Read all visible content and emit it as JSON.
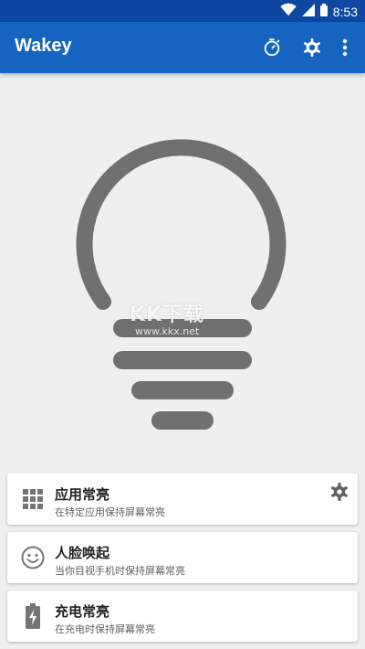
{
  "status_bar": {
    "time": "8:53",
    "icons": [
      "wifi-icon",
      "cellular-signal-icon",
      "battery-icon"
    ],
    "background": "#0d47a1"
  },
  "app_bar": {
    "title": "Wakey",
    "background": "#1565c0",
    "actions": [
      "timer-icon",
      "settings-icon",
      "more-vert-icon"
    ]
  },
  "bulb": {
    "color": "#707070",
    "icon": "lightbulb-icon"
  },
  "watermark": {
    "main": "KK下载",
    "sub": "www.kkx.net"
  },
  "cards": [
    {
      "title": "应用常亮",
      "subtitle": "在特定应用保持屏幕常亮",
      "icon": "apps-grid-icon",
      "has_settings": true
    },
    {
      "title": "人脸唤起",
      "subtitle": "当你目视手机时保持屏幕常亮",
      "icon": "face-icon"
    },
    {
      "title": "充电常亮",
      "subtitle": "在充电时保持屏幕常亮",
      "icon": "battery-charging-icon"
    }
  ],
  "colors": {
    "icon": "#757575",
    "card_background": "#ffffff",
    "page_background": "#efefef"
  }
}
